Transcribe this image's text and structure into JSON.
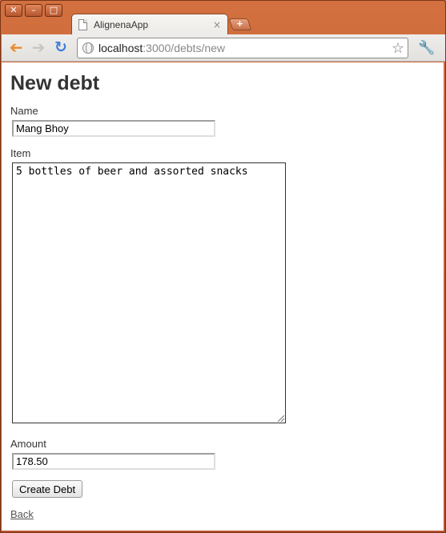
{
  "window": {
    "controls": {
      "close": "✕",
      "minimize": "–",
      "maximize": "□"
    }
  },
  "tab": {
    "title": "AlignenaApp",
    "close": "×"
  },
  "new_tab": "+",
  "toolbar": {
    "back_icon": "back-arrow-icon",
    "forward_icon": "forward-arrow-icon",
    "reload_icon": "reload-icon",
    "url_host": "localhost",
    "url_path": ":3000/debts/new"
  },
  "form": {
    "title": "New debt",
    "name_label": "Name",
    "name_value": "Mang Bhoy",
    "item_label": "Item",
    "item_value": "5 bottles of beer and assorted snacks",
    "amount_label": "Amount",
    "amount_value": "178.50",
    "submit_label": "Create Debt",
    "back_link": "Back"
  }
}
